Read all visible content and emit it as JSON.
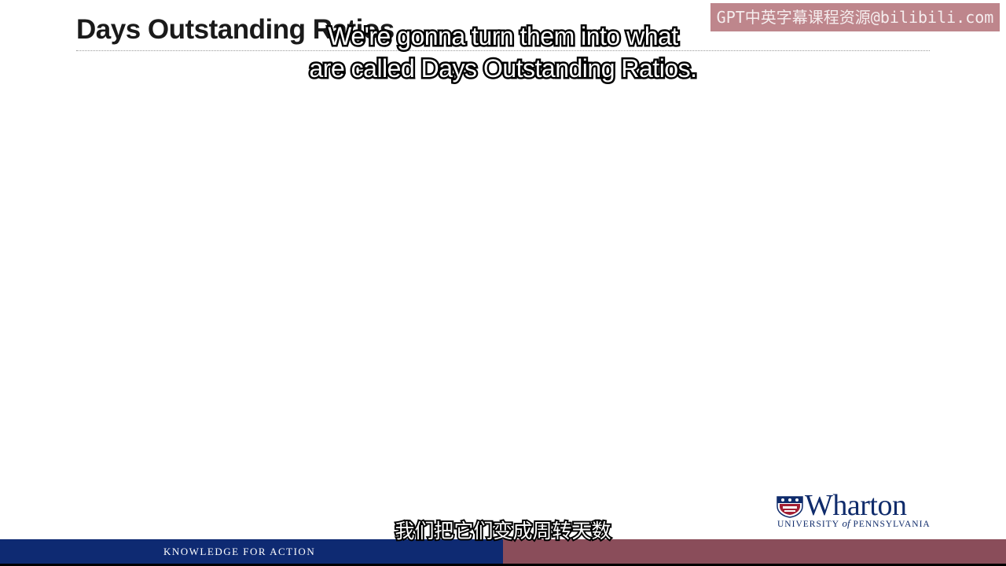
{
  "slide": {
    "title": "Days Outstanding Ratios"
  },
  "subtitles": {
    "english_line1": "We're gonna turn them into what",
    "english_line2": "are called Days Outstanding Ratios.",
    "chinese": "我们把它们变成周转天数"
  },
  "watermark": {
    "text": "GPT中英字幕课程资源@bilibili.com"
  },
  "logo": {
    "wordmark": "Wharton",
    "sub_prefix": "UNIVERSITY ",
    "sub_of": "of",
    "sub_suffix": " PENNSYLVANIA",
    "icon": "penn-shield-icon"
  },
  "footer": {
    "tagline": "KNOWLEDGE FOR ACTION"
  },
  "colors": {
    "footer_blue": "#0e2a72",
    "footer_maroon": "#8a4d5a",
    "brand_navy": "#0f2b6b"
  }
}
